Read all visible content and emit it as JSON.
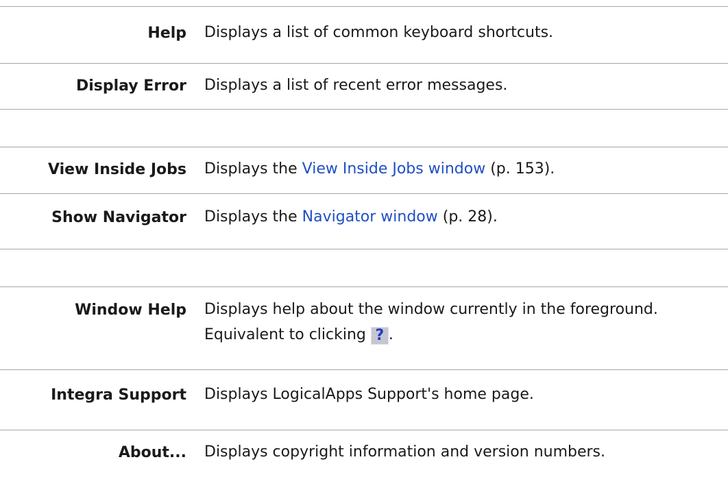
{
  "groups": [
    {
      "rows": [
        {
          "term": "Help",
          "desc": "Displays a list of common keyboard shortcuts."
        },
        {
          "term": "Display Error",
          "desc": "Displays a list of recent error messages."
        }
      ]
    },
    {
      "rows": [
        {
          "term": "View Inside Jobs",
          "desc_prefix": "Displays the ",
          "link": "View Inside Jobs window",
          "desc_suffix": " (p. 153)."
        },
        {
          "term": "Show Navigator",
          "desc_prefix": "Displays the ",
          "link": "Navigator window",
          "desc_suffix": " (p. 28)."
        }
      ]
    },
    {
      "rows": [
        {
          "term": "Window Help",
          "desc_line1": "Displays help about the window currently in the foreground.",
          "desc_line2_prefix": "Equivalent to clicking ",
          "icon": "help-question-icon",
          "icon_glyph": "?",
          "desc_line2_suffix": "."
        },
        {
          "term": "Integra Support",
          "desc": "Displays LogicalApps Support's home page."
        },
        {
          "term": "About...",
          "desc": "Displays copyright information and version numbers."
        }
      ]
    }
  ],
  "colors": {
    "link": "#1f4fc4",
    "rule": "#a6a6a6",
    "help_icon_bg": "#c6c6d2",
    "help_icon_fg": "#1f3fbf"
  }
}
